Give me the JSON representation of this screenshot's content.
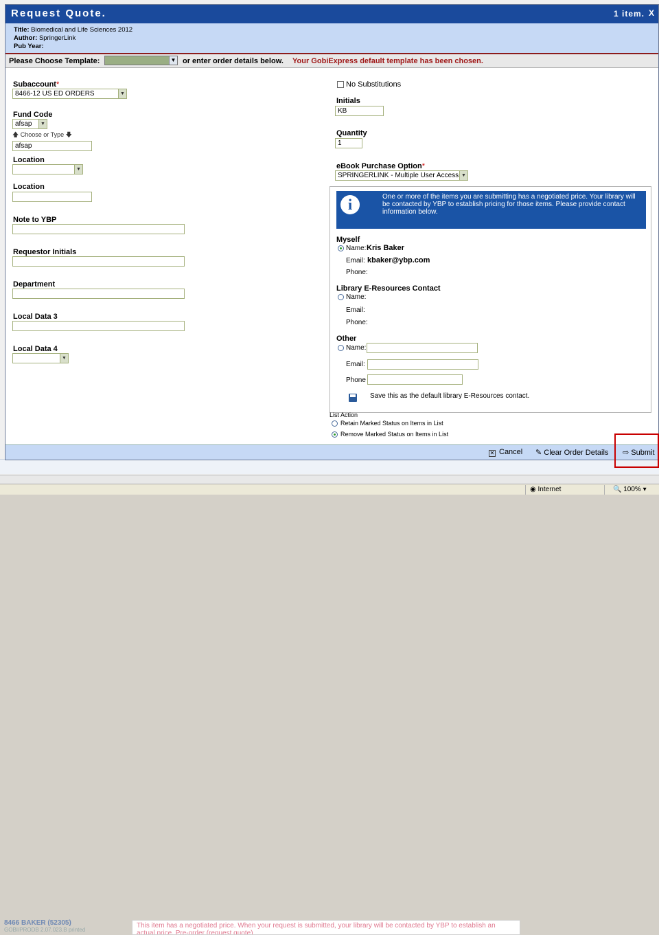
{
  "dialog": {
    "title": "Request Quote.",
    "item_count": "1 item.",
    "close_glyph": "X",
    "info": {
      "title_label": "Title:",
      "title_value": "Biomedical and Life Sciences 2012",
      "author_label": "Author:",
      "author_value": "SpringerLink",
      "pubyear_label": "Pub Year:"
    },
    "template": {
      "label": "Please Choose Template:",
      "or_text": "or enter order details below.",
      "chosen_text": "Your GobiExpress default template has been chosen."
    }
  },
  "left": {
    "subaccount_label": "Subaccount",
    "subaccount_value": "8466-12 US ED ORDERS",
    "fund_code_label": "Fund Code",
    "fund_code_select": "afsap",
    "choose_or_type": "Choose or Type",
    "fund_code_text": "afsap",
    "location1_label": "Location",
    "location2_label": "Location",
    "note_label": "Note to YBP",
    "requestor_label": "Requestor Initials",
    "department_label": "Department",
    "local3_label": "Local Data 3",
    "local4_label": "Local Data 4"
  },
  "right": {
    "no_subs_label": "No Substitutions",
    "initials_label": "Initials",
    "initials_value": "KB",
    "quantity_label": "Quantity",
    "quantity_value": "1",
    "ebook_label": "eBook Purchase Option",
    "ebook_value": "SPRINGERLINK - Multiple User Access",
    "negotiated_text": "One or more of the items you are submitting has a negotiated price. Your library will be contacted by YBP to establish pricing for those items. Please provide contact information below.",
    "myself_label": "Myself",
    "name_label": "Name:",
    "myself_name": "Kris Baker",
    "email_label": "Email:",
    "myself_email": "kbaker@ybp.com",
    "phone_label": "Phone:",
    "eres_label": "Library E-Resources Contact",
    "other_label": "Other",
    "other_phone_label": "Phone",
    "save_default_text": "Save this as the default library E-Resources contact.",
    "list_action_label": "List Action",
    "retain_label": "Retain Marked Status on Items in List",
    "remove_label": "Remove Marked Status on Items in List"
  },
  "footer": {
    "cancel": "Cancel",
    "clear": "Clear Order Details",
    "submit": "Submit"
  },
  "background": {
    "account": "8466 BAKER (52305)",
    "version": "GOBI/PRODB 2.07.023.B printed",
    "message": "This item has a negotiated price. When your request is submitted, your library will be contacted by YBP to establish an actual price. Pre-order (request quote)"
  },
  "statusbar": {
    "zone": "Internet",
    "zoom": "100%"
  }
}
